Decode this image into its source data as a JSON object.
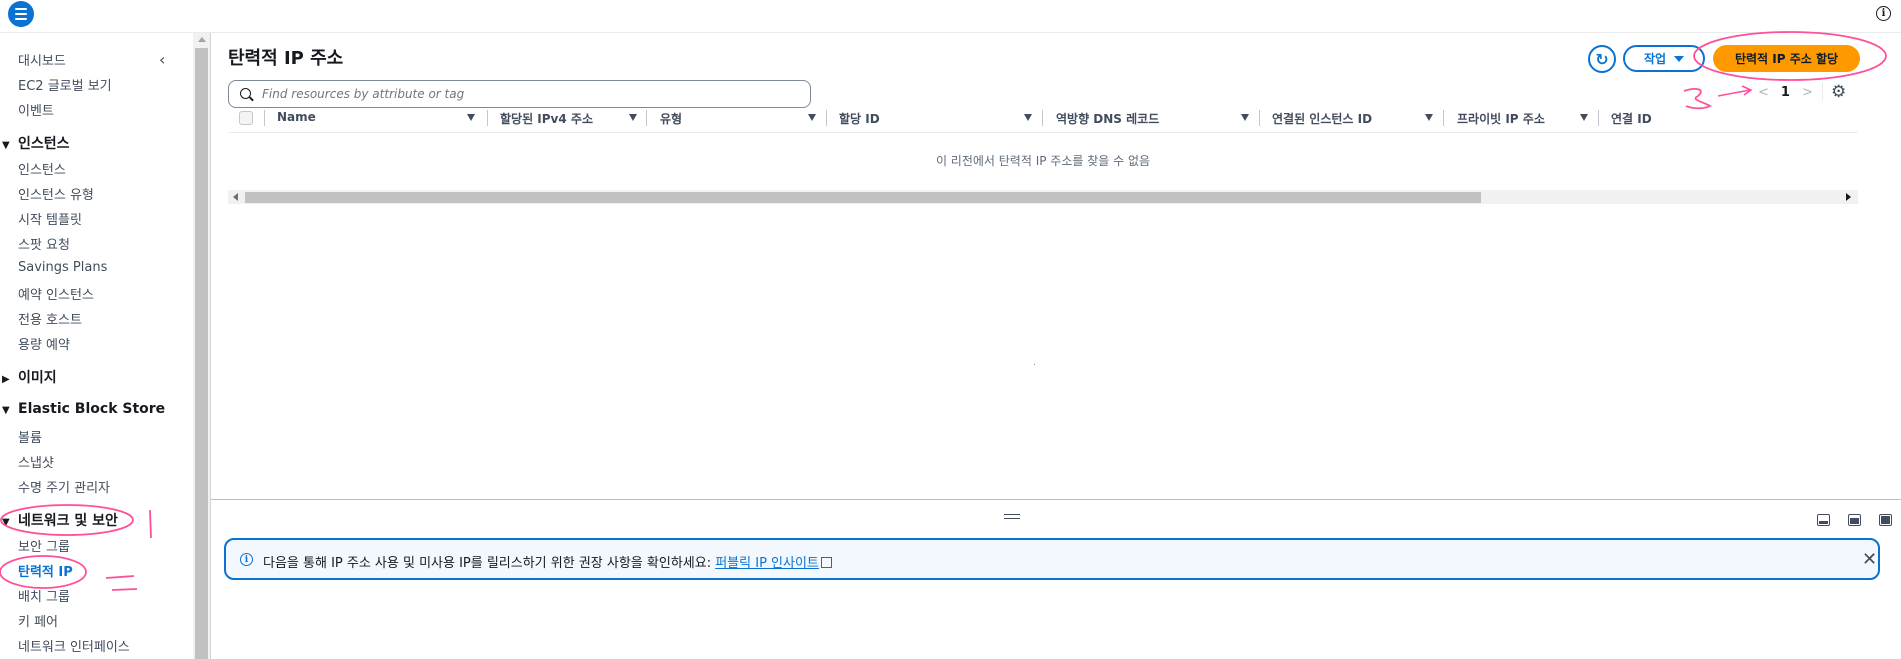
{
  "topbar": {
    "info_glyph": "i"
  },
  "sidebar": {
    "items_top": [
      "대시보드",
      "EC2 글로벌 보기",
      "이벤트"
    ],
    "instances": {
      "title": "인스턴스",
      "items": [
        "인스턴스",
        "인스턴스 유형",
        "시작 템플릿",
        "스팟 요청",
        "Savings Plans",
        "예약 인스턴스",
        "전용 호스트",
        "용량 예약"
      ]
    },
    "images": {
      "title": "이미지"
    },
    "ebs": {
      "title": "Elastic Block Store",
      "items": [
        "볼륨",
        "스냅샷",
        "수명 주기 관리자"
      ]
    },
    "network": {
      "title": "네트워크 및 보안",
      "items": [
        "보안 그룹",
        "탄력적 IP",
        "배치 그룹",
        "키 페어",
        "네트워크 인터페이스"
      ]
    },
    "active_item": "탄력적 IP"
  },
  "main": {
    "title": "탄력적 IP 주소",
    "search_placeholder": "Find resources by attribute or tag",
    "actions_label": "작업",
    "allocate_label": "탄력적 IP 주소 할당",
    "pager": {
      "prev": "<",
      "page": "1",
      "next": ">"
    },
    "columns": [
      "Name",
      "할당된 IPv4 주소",
      "유형",
      "할당 ID",
      "역방향 DNS 레코드",
      "연결된 인스턴스 ID",
      "프라이빗 IP 주소",
      "연결 ID"
    ],
    "empty_message": "이 리전에서 탄력적 IP 주소를 찾을 수 없음"
  },
  "flash": {
    "message": "다음을 통해 IP 주소 사용 및 미사용 IP를 릴리스하기 위한 권장 사항을 확인하세요: ",
    "link_text": "퍼블릭 IP 인사이트"
  },
  "annotations": [
    "1",
    "2",
    "3"
  ],
  "colors": {
    "accent": "#0972d3",
    "primary_button": "#ff9900",
    "annotation": "#ff4f9a"
  }
}
